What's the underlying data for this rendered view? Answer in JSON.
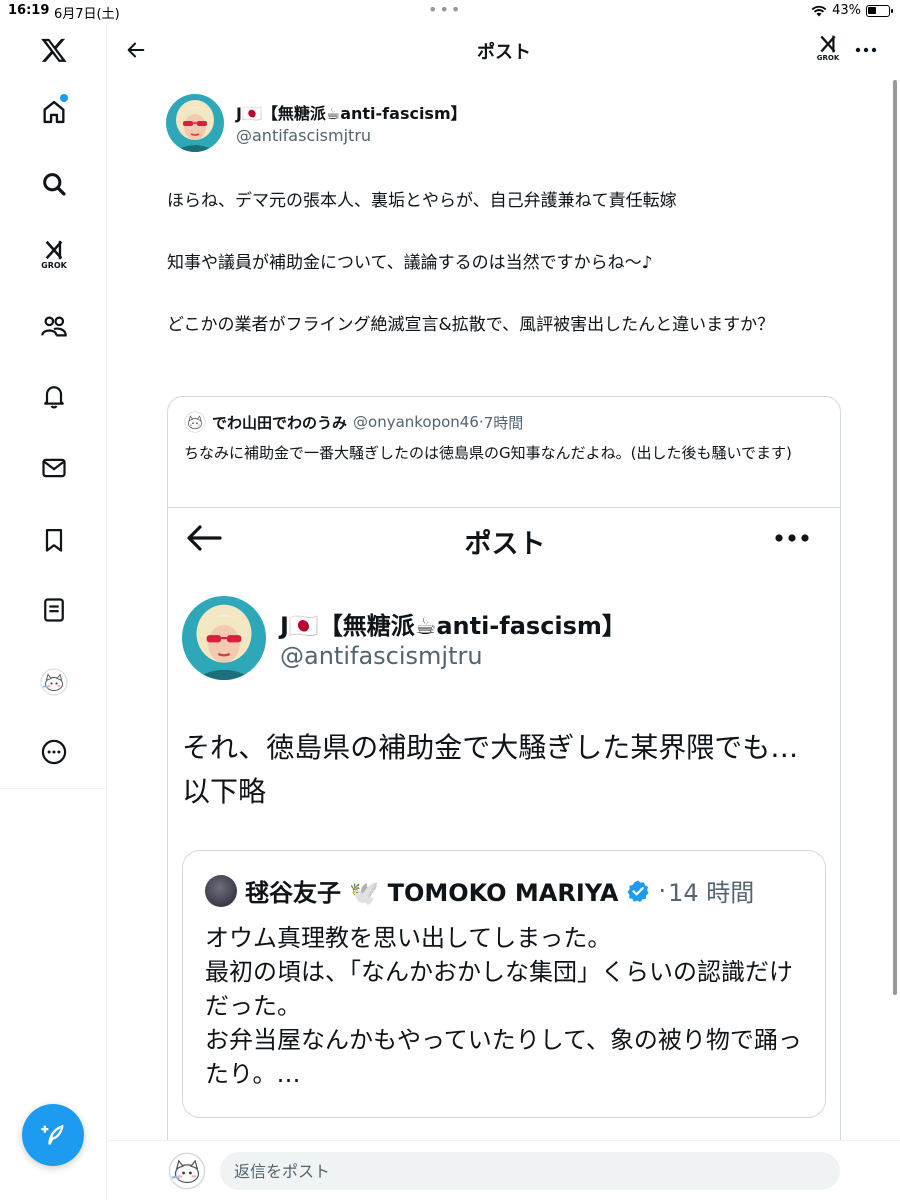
{
  "status_bar": {
    "time": "16:19",
    "date": "6月7日(土)",
    "battery": "43%",
    "battery_level": 0.43
  },
  "header": {
    "title": "ポスト",
    "grok_label": "GROK"
  },
  "sidebar": {
    "grok_label": "GROK",
    "items": [
      {
        "name": "x-logo",
        "icon": "x-logo-icon"
      },
      {
        "name": "home",
        "icon": "home-icon",
        "has_notification": true
      },
      {
        "name": "explore",
        "icon": "search-icon"
      },
      {
        "name": "grok",
        "icon": "grok-icon"
      },
      {
        "name": "communities",
        "icon": "people-icon"
      },
      {
        "name": "notifications",
        "icon": "bell-icon"
      },
      {
        "name": "messages",
        "icon": "envelope-icon"
      },
      {
        "name": "bookmarks",
        "icon": "bookmark-icon"
      },
      {
        "name": "lists",
        "icon": "list-icon"
      },
      {
        "name": "profile",
        "icon": "avatar"
      },
      {
        "name": "more",
        "icon": "more-circle-icon"
      }
    ],
    "compose_icon": "compose-icon"
  },
  "tweet": {
    "author_name": "J🇯🇵【無糖派☕anti-fascism】",
    "author_handle": "@antifascismjtru",
    "lines": [
      "ほらね、デマ元の張本人、裏垢とやらが、自己弁護兼ねて責任転嫁",
      "",
      "知事や議員が補助金について、議論するのは当然ですからね〜♪",
      "",
      "どこかの業者がフライング絶滅宣言&拡散で、風評被害出したんと違いますか？"
    ]
  },
  "quote": {
    "author_name": "でわ山田でわのうみ",
    "author_handle": "@onyankopon46",
    "separator": "·",
    "time": "7時間",
    "text": "ちなみに補助金で一番大騒ぎしたのは徳島県のG知事なんだよね。(出した後も騒いでます)",
    "screenshot": {
      "title": "ポスト",
      "author_name": "J🇯🇵【無糖派☕anti-fascism】",
      "author_handle": "@antifascismjtru",
      "text_line1": "それ、徳島県の補助金で大騒ぎした某界隈でも…",
      "text_line2": "以下略",
      "inner_quote": {
        "author_name": "毬谷友子 🕊️ TOMOKO MARIYA",
        "separator": "·",
        "time": "14 時間",
        "lines": [
          "オウム真理教を思い出してしまった。",
          "最初の頃は、「なんかおかしな集団」くらいの認識だけだった。",
          "お弁当屋なんかもやっていたりして、象の被り物で踊ったり。…"
        ]
      }
    }
  },
  "reply": {
    "placeholder": "返信をポスト"
  },
  "colors": {
    "accent": "#1d9bf0",
    "text": "#0f1419",
    "secondary": "#536471",
    "border": "#cfd9de"
  }
}
